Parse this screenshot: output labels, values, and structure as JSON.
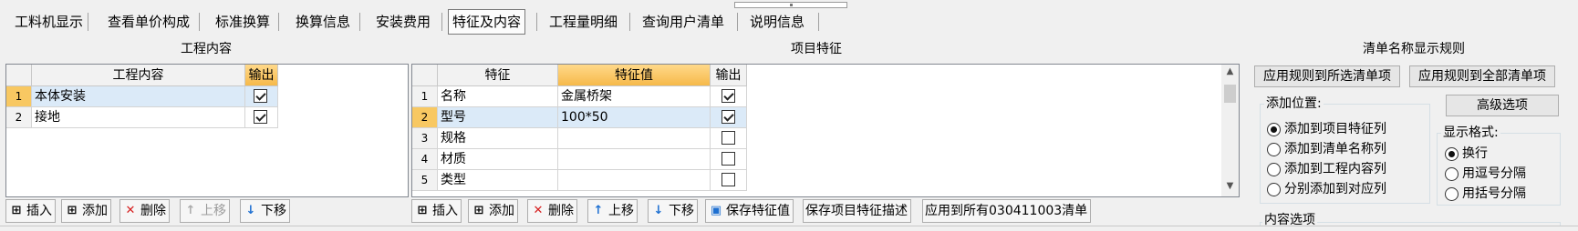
{
  "tabs": [
    {
      "label": "工料机显示"
    },
    {
      "label": "查看单价构成"
    },
    {
      "label": "标准换算"
    },
    {
      "label": "换算信息"
    },
    {
      "label": "安装费用"
    },
    {
      "label": "特征及内容",
      "active": true
    },
    {
      "label": "工程量明细"
    },
    {
      "label": "查询用户清单"
    },
    {
      "label": "说明信息"
    }
  ],
  "work_content": {
    "title": "工程内容",
    "headers": {
      "content": "工程内容",
      "output": "输出"
    },
    "rows": [
      {
        "no": "1",
        "content": "本体安装",
        "output": true
      },
      {
        "no": "2",
        "content": "接地",
        "output": true
      }
    ],
    "toolbar": {
      "insert": "插入",
      "add": "添加",
      "delete": "删除",
      "up": "上移",
      "down": "下移"
    }
  },
  "item_features": {
    "title": "项目特征",
    "headers": {
      "feature": "特征",
      "value": "特征值",
      "output": "输出"
    },
    "rows": [
      {
        "no": "1",
        "feature": "名称",
        "value": "金属桥架",
        "output": true
      },
      {
        "no": "2",
        "feature": "型号",
        "value": "100*50",
        "output": true
      },
      {
        "no": "3",
        "feature": "规格",
        "value": "",
        "output": false
      },
      {
        "no": "4",
        "feature": "材质",
        "value": "",
        "output": false
      },
      {
        "no": "5",
        "feature": "类型",
        "value": "",
        "output": false
      }
    ],
    "toolbar": {
      "insert": "插入",
      "add": "添加",
      "delete": "删除",
      "up": "上移",
      "down": "下移",
      "save_value": "保存特征值",
      "save_desc": "保存项目特征描述",
      "apply_all": "应用到所有030411003清单"
    }
  },
  "rules": {
    "title": "清单名称显示规则",
    "apply_selected": "应用规则到所选清单项",
    "apply_all": "应用规则到全部清单项",
    "advanced": "高级选项",
    "position_label": "添加位置:",
    "positions": [
      "添加到项目特征列",
      "添加到清单名称列",
      "添加到工程内容列",
      "分别添加到对应列"
    ],
    "format_label": "显示格式:",
    "formats": [
      "换行",
      "用逗号分隔",
      "用括号分隔"
    ],
    "content_options": "内容选项"
  },
  "colors": {
    "header_orange": "#f6b94a",
    "row_highlight": "#dbeaf8"
  }
}
